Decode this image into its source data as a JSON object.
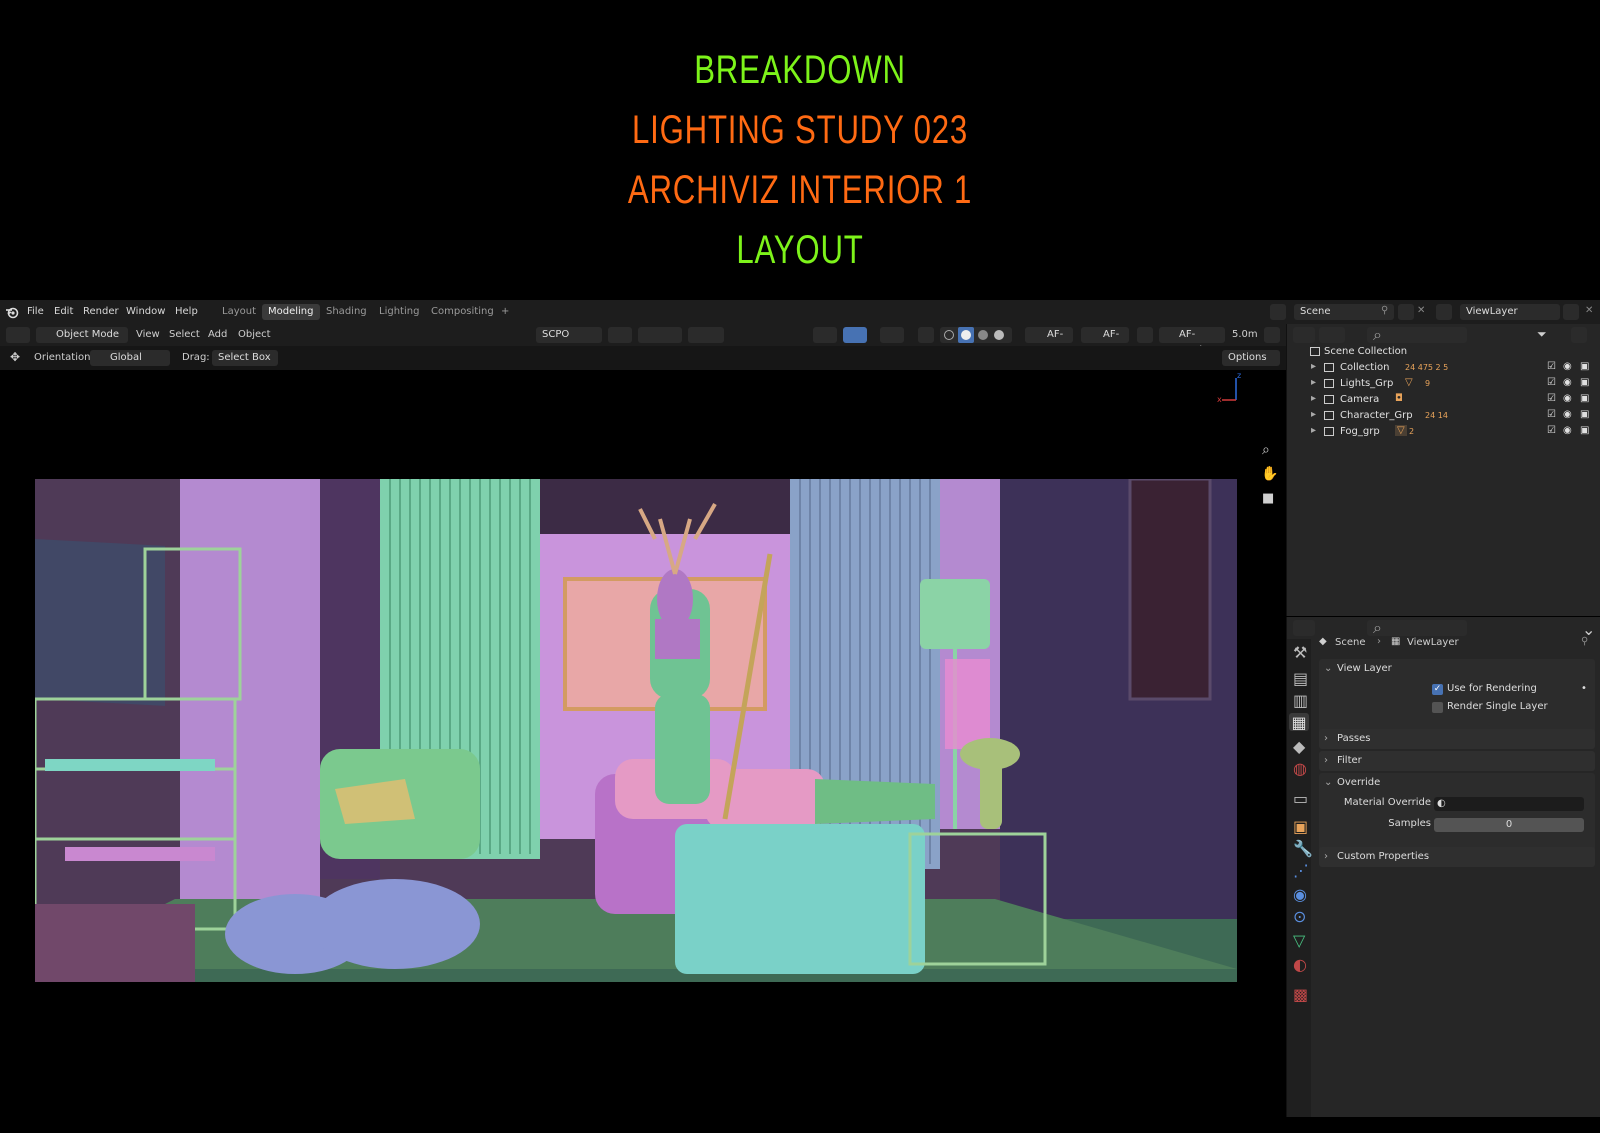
{
  "poster": {
    "line1": "BREAKDOWN",
    "line2": "LIGHTING  STUDY  023",
    "line3": "ARCHIVIZ INTERIOR 1",
    "line4": "LAYOUT",
    "colors": {
      "green": "#7df31a",
      "orange": "#ff6a13"
    }
  },
  "menu": [
    "File",
    "Edit",
    "Render",
    "Window",
    "Help"
  ],
  "workspaces": [
    "Layout",
    "Modeling",
    "Shading",
    "Lighting",
    "Compositing",
    "+"
  ],
  "active_workspace": "Modeling",
  "scene": {
    "name": "Scene",
    "view_layer": "ViewLayer"
  },
  "header": {
    "mode": "Object Mode",
    "view_menus": [
      "View",
      "Select",
      "Add",
      "Object"
    ],
    "scpo": "SCPO",
    "af_s": "AF-S",
    "af_c": "AF-C",
    "af_track": "AF-Track",
    "distance": "5.0m"
  },
  "tool_header": {
    "orientation_label": "Orientation:",
    "orientation_value": "Global",
    "drag_label": "Drag:",
    "drag_value": "Select Box",
    "options": "Options"
  },
  "gizmo": {
    "x": "x",
    "z": "z"
  },
  "outliner": {
    "root": "Scene Collection",
    "items": [
      {
        "label": "Collection",
        "counts": "24 475 2 5"
      },
      {
        "label": "Lights_Grp",
        "counts": "9"
      },
      {
        "label": "Camera",
        "counts": ""
      },
      {
        "label": "Character_Grp",
        "counts": "24 14"
      },
      {
        "label": "Fog_grp",
        "counts": "2"
      }
    ]
  },
  "properties": {
    "breadcrumb_scene": "Scene",
    "breadcrumb_layer": "ViewLayer",
    "view_layer_panel": "View Layer",
    "use_for_rendering": "Use for Rendering",
    "use_for_rendering_checked": true,
    "render_single_layer": "Render Single Layer",
    "render_single_layer_checked": false,
    "passes": "Passes",
    "filter": "Filter",
    "override": "Override",
    "material_override": "Material Override",
    "samples_label": "Samples",
    "samples_value": "0",
    "custom_properties": "Custom Properties"
  }
}
